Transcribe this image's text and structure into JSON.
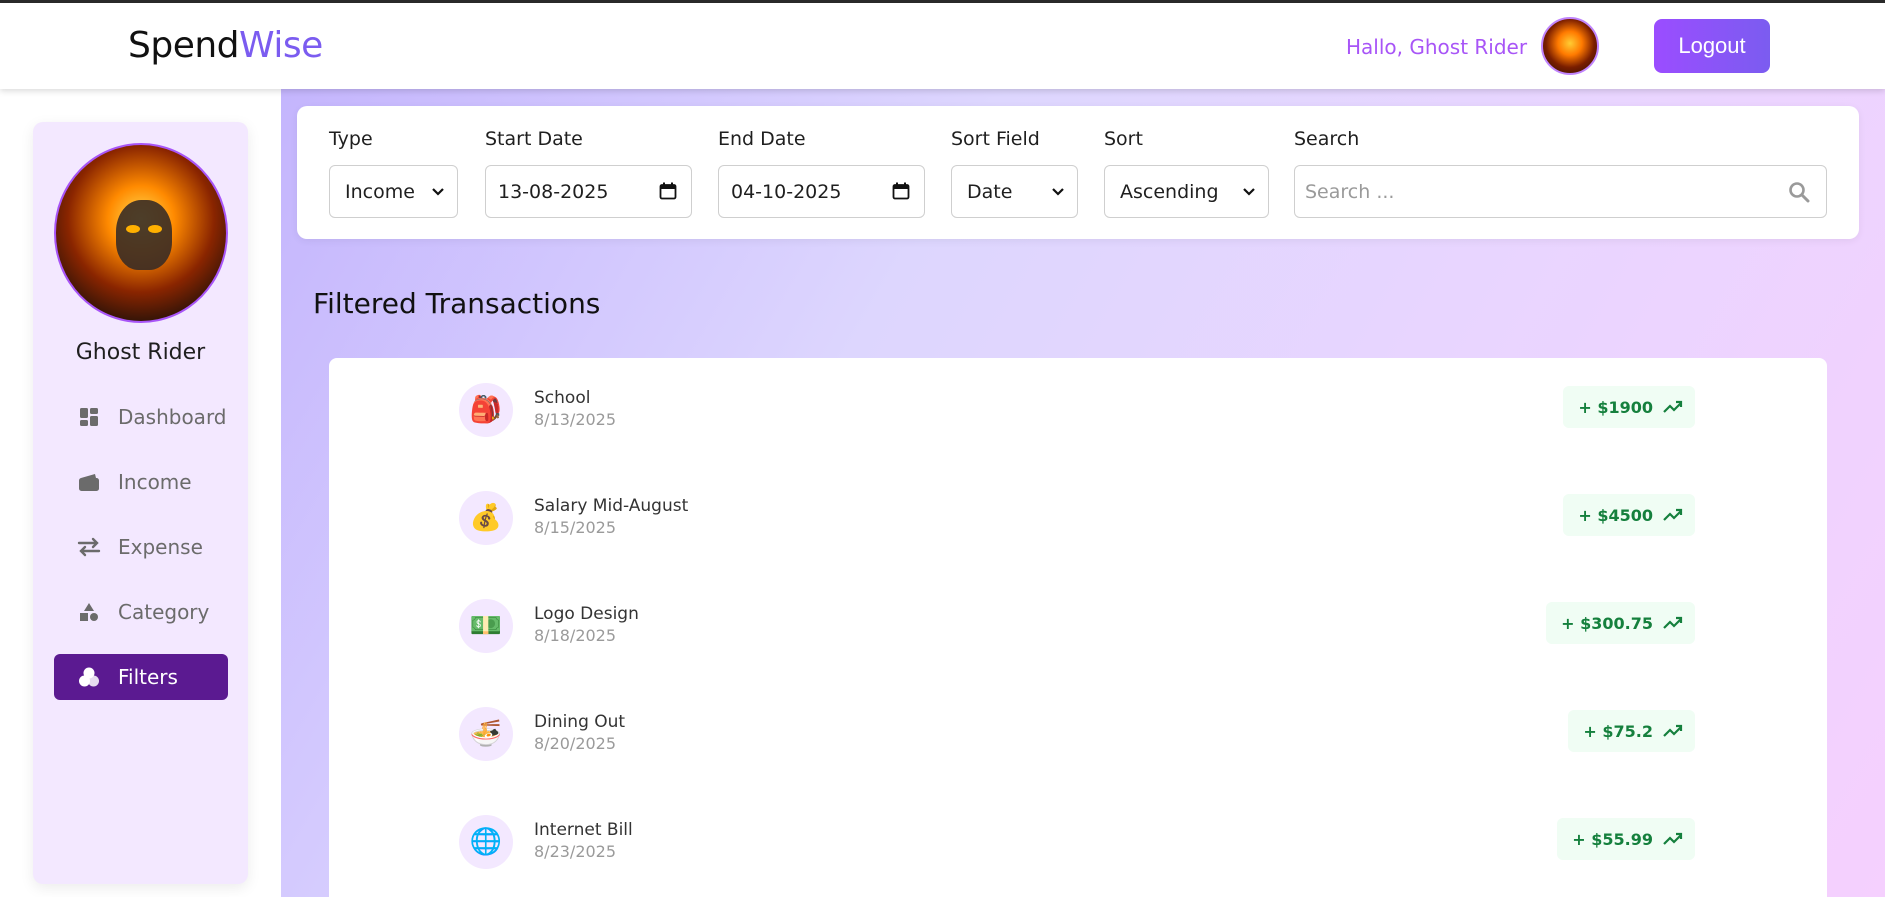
{
  "header": {
    "logo_part1": "Spend",
    "logo_part2": "Wise",
    "greeting": "Hallo, Ghost Rider",
    "logout_label": "Logout"
  },
  "sidebar": {
    "user_name": "Ghost Rider",
    "items": [
      {
        "label": "Dashboard",
        "icon": "dashboard-icon"
      },
      {
        "label": "Income",
        "icon": "wallet-icon"
      },
      {
        "label": "Expense",
        "icon": "swap-arrows-icon"
      },
      {
        "label": "Category",
        "icon": "shapes-icon"
      },
      {
        "label": "Filters",
        "icon": "filter-icon",
        "active": true
      }
    ]
  },
  "filters": {
    "type_label": "Type",
    "type_value": "Income",
    "start_label": "Start Date",
    "start_value": "13-08-2025",
    "end_label": "End Date",
    "end_value": "04-10-2025",
    "sort_field_label": "Sort Field",
    "sort_field_value": "Date",
    "sort_label": "Sort",
    "sort_value": "Ascending",
    "search_label": "Search",
    "search_placeholder": "Search ..."
  },
  "main": {
    "title": "Filtered Transactions",
    "transactions": [
      {
        "name": "School",
        "date": "8/13/2025",
        "amount": "+ $1900",
        "emoji": "🎒"
      },
      {
        "name": "Salary Mid-August",
        "date": "8/15/2025",
        "amount": "+ $4500",
        "emoji": "💰"
      },
      {
        "name": "Logo Design",
        "date": "8/18/2025",
        "amount": "+ $300.75",
        "emoji": "💵"
      },
      {
        "name": "Dining Out",
        "date": "8/20/2025",
        "amount": "+ $75.2",
        "emoji": "🍜"
      },
      {
        "name": "Internet Bill",
        "date": "8/23/2025",
        "amount": "+ $55.99",
        "emoji": "🌐"
      }
    ]
  },
  "colors": {
    "accent": "#7b5cf0",
    "active_nav": "#5b1a91",
    "income_text": "#15803d"
  }
}
